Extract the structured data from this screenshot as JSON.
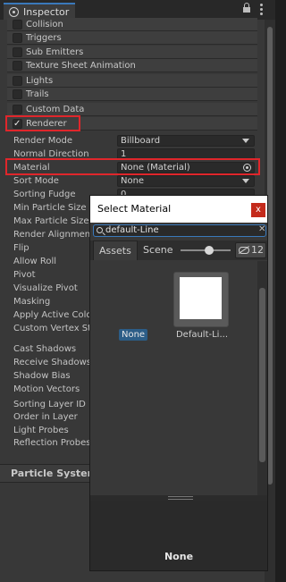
{
  "inspector": {
    "tab_label": "Inspector",
    "modules": [
      {
        "label": "Collision",
        "enabled": false
      },
      {
        "label": "Triggers",
        "enabled": false
      },
      {
        "label": "Sub Emitters",
        "enabled": false
      },
      {
        "label": "Texture Sheet Animation",
        "enabled": false
      },
      {
        "label": "Lights",
        "enabled": false
      },
      {
        "label": "Trails",
        "enabled": false
      },
      {
        "label": "Custom Data",
        "enabled": false
      },
      {
        "label": "Renderer",
        "enabled": true
      }
    ],
    "renderer_props": [
      {
        "label": "Render Mode",
        "value": "Billboard",
        "kind": "dropdown"
      },
      {
        "label": "Normal Direction",
        "value": "1",
        "kind": "number"
      },
      {
        "label": "Material",
        "value": "None (Material)",
        "kind": "object"
      },
      {
        "label": "Sort Mode",
        "value": "None",
        "kind": "dropdown"
      },
      {
        "label": "Sorting Fudge",
        "value": "0",
        "kind": "number"
      },
      {
        "label": "Min Particle Size",
        "value": "",
        "kind": "none"
      },
      {
        "label": "Max Particle Size",
        "value": "",
        "kind": "none"
      },
      {
        "label": "Render Alignment",
        "value": "",
        "kind": "none"
      },
      {
        "label": "Flip",
        "value": "",
        "kind": "none"
      },
      {
        "label": "Allow Roll",
        "value": "",
        "kind": "none"
      },
      {
        "label": "Pivot",
        "value": "",
        "kind": "none"
      },
      {
        "label": "Visualize Pivot",
        "value": "",
        "kind": "none"
      },
      {
        "label": "Masking",
        "value": "",
        "kind": "none"
      },
      {
        "label": "Apply Active Colo",
        "value": "",
        "kind": "none"
      },
      {
        "label": "Custom Vertex St",
        "value": "",
        "kind": "none"
      },
      {
        "label": "Cast Shadows",
        "value": "",
        "kind": "none"
      },
      {
        "label": "Receive Shadows",
        "value": "",
        "kind": "none"
      },
      {
        "label": "Shadow Bias",
        "value": "",
        "kind": "none"
      },
      {
        "label": "Motion Vectors",
        "value": "",
        "kind": "none"
      },
      {
        "label": "Sorting Layer ID",
        "value": "",
        "kind": "none"
      },
      {
        "label": "Order in Layer",
        "value": "",
        "kind": "none"
      },
      {
        "label": "Light Probes",
        "value": "",
        "kind": "none"
      },
      {
        "label": "Reflection Probes",
        "value": "",
        "kind": "none"
      }
    ],
    "footer_title": "Particle Systen"
  },
  "picker": {
    "title": "Select Material",
    "close_label": "x",
    "search_value": "default-Line",
    "tab_assets": "Assets",
    "tab_scene": "Scene",
    "hidden_count": "12",
    "none_item": "None",
    "asset_label": "Default-Li...",
    "preview_label": "None"
  },
  "colors": {
    "highlight": "#e0262b",
    "accent": "#3a79bb",
    "selection": "#2c5d87",
    "close": "#c42b1c"
  }
}
